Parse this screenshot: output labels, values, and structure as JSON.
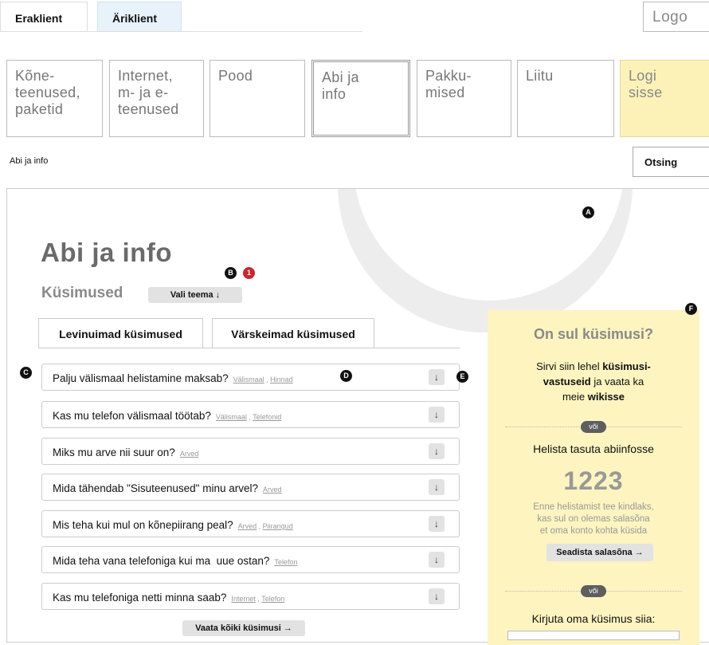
{
  "top_tabs": {
    "private": "Eraklient",
    "business": "Äriklient"
  },
  "logo": "Logo",
  "nav": [
    {
      "label": "Kõne-\nteenused,\npaketid"
    },
    {
      "label": "Internet,\nm- ja e-\nteenused"
    },
    {
      "label": "Pood"
    },
    {
      "label": "Abi ja\ninfo"
    },
    {
      "label": "Pakku-\nmised"
    },
    {
      "label": "Liitu"
    },
    {
      "label": "Logi\nsisse"
    }
  ],
  "breadcrumb": "Abi ja info",
  "search_label": "Otsing",
  "page_title": "Abi ja info",
  "questions_heading": "Küsimused",
  "theme_button": "Vali teema ↓",
  "markers": {
    "a": "A",
    "b": "B",
    "one": "1",
    "c": "C",
    "d": "D",
    "e": "E",
    "f": "F"
  },
  "question_tabs": {
    "popular": "Levinuimad küsimused",
    "recent": "Värskeimad küsimused"
  },
  "questions": [
    {
      "text": "Palju välismaal helistamine maksab?",
      "tags": [
        "Välismaal",
        "Hinnad"
      ]
    },
    {
      "text": "Kas mu telefon välismaal töötab?",
      "tags": [
        "Välismaal",
        "Telefonid"
      ]
    },
    {
      "text": "Miks mu arve nii suur on?",
      "tags": [
        "Arved"
      ]
    },
    {
      "text": "Mida tähendab \"Sisuteenused\" minu arvel?",
      "tags": [
        "Arved"
      ]
    },
    {
      "text": "Mis teha kui mul on kõnepiirang peal?",
      "tags": [
        "Arved",
        "Piirangud"
      ]
    },
    {
      "text": "Mida teha vana telefoniga kui ma  uue ostan?",
      "tags": [
        "Telefon"
      ]
    },
    {
      "text": "Kas mu telefoniga netti minna saab?",
      "tags": [
        "Internet",
        "Telefon"
      ]
    }
  ],
  "expand_icon": "↓",
  "view_all_button": "Vaata kõiki küsimusi →",
  "sidebar": {
    "title": "On sul küsimusi?",
    "intro_pre": "Sirvi siin lehel ",
    "intro_bold1": "küsimusi-\nvastuseid",
    "intro_mid": " ja vaata ka\nmeie ",
    "intro_bold2": "wikisse",
    "or1": "või",
    "call_text": "Helista tasuta abiinfosse",
    "phone": "1223",
    "note": "Enne helistamist tee kindlaks,\nkas sul on olemas salasõna\net oma konto kohta küsida",
    "password_button": "Seadista salasõna →",
    "or2": "või",
    "write_text": "Kirjuta oma küsimus siia:"
  },
  "colors": {
    "login_bg": "#fcf2b8",
    "sidebar_bg": "#fdf4bf",
    "marker_red": "#d0232a"
  }
}
